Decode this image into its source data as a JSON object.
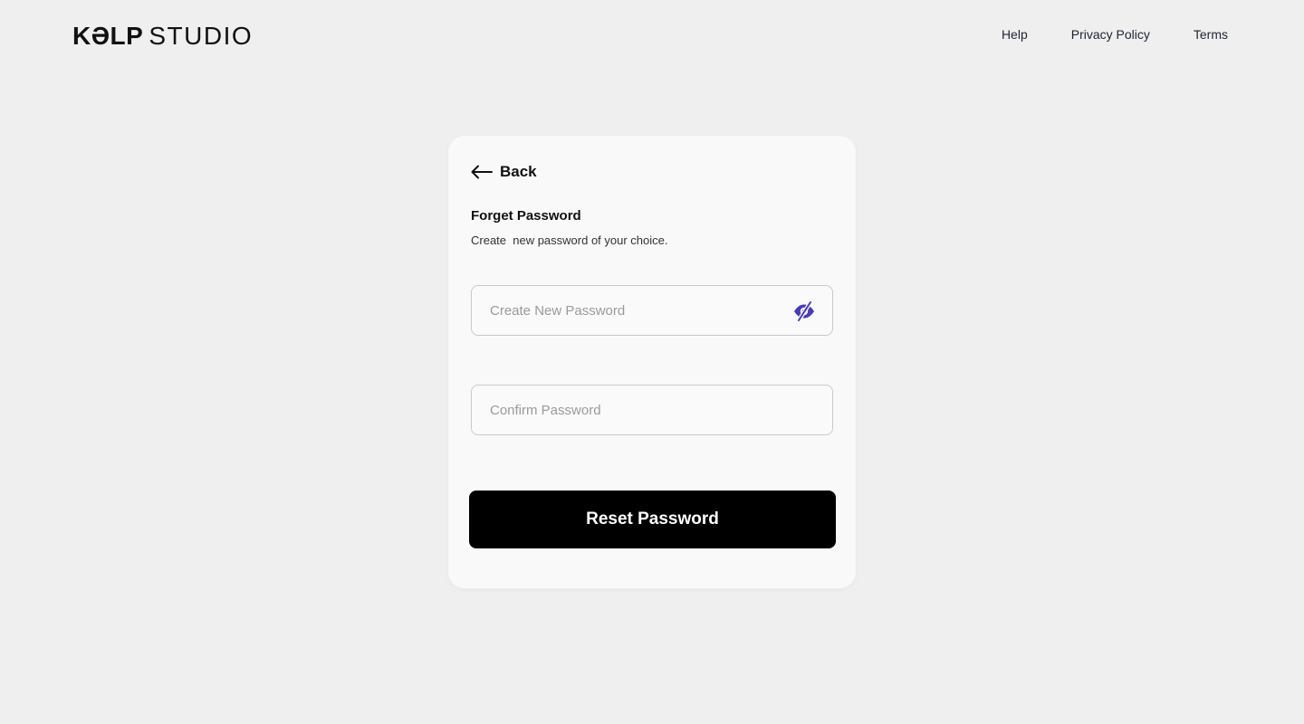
{
  "header": {
    "logo_strong": "KƏLP",
    "logo_light": "STUDIO",
    "nav": [
      {
        "label": "Help"
      },
      {
        "label": "Privacy Policy"
      },
      {
        "label": "Terms"
      }
    ]
  },
  "card": {
    "back_label": "Back",
    "title": "Forget Password",
    "subtitle": "Create  new password of your choice.",
    "new_password": {
      "placeholder": "Create New Password",
      "value": ""
    },
    "confirm_password": {
      "placeholder": "Confirm Password",
      "value": ""
    },
    "visibility_icon": "eye-slash-icon",
    "submit_label": "Reset Password"
  },
  "colors": {
    "background": "#efefef",
    "card": "#f9f9f9",
    "button": "#000000",
    "accent_icon": "#4b3bb8"
  }
}
